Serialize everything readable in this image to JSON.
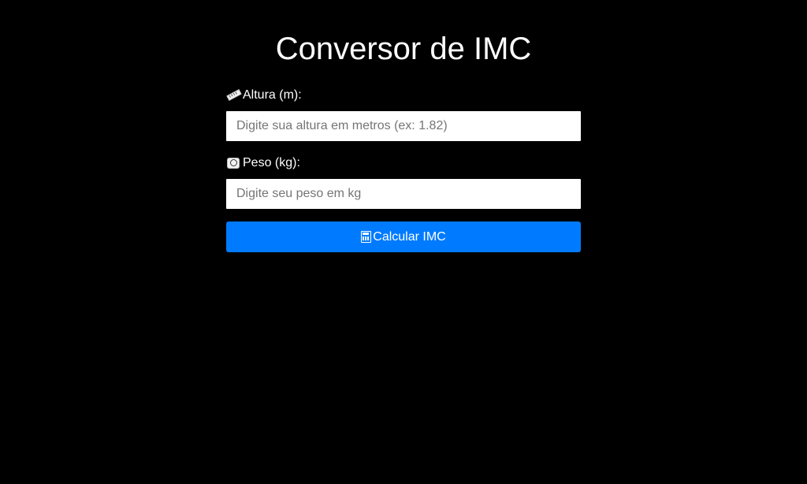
{
  "page": {
    "title": "Conversor de IMC"
  },
  "form": {
    "altura": {
      "label": "Altura (m):",
      "icon": "ruler-icon",
      "placeholder": "Digite sua altura em metros (ex: 1.82)",
      "value": ""
    },
    "peso": {
      "label": "Peso (kg):",
      "icon": "scale-icon",
      "placeholder": "Digite seu peso em kg",
      "value": ""
    },
    "submit": {
      "label": "Calcular IMC",
      "icon": "calculator-icon"
    }
  },
  "colors": {
    "background": "#000000",
    "text": "#ffffff",
    "button": "#007bff",
    "input_background": "#ffffff"
  }
}
